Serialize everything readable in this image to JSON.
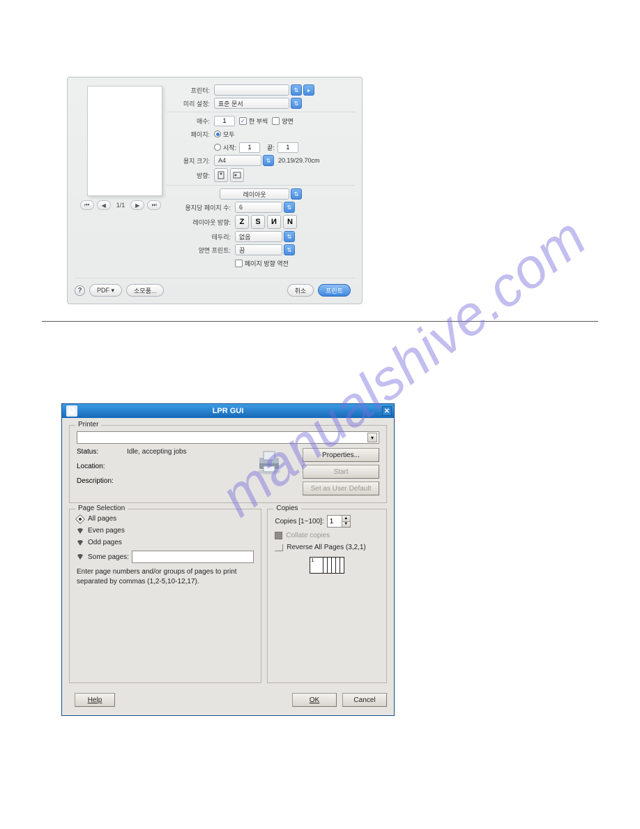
{
  "mac": {
    "labels": {
      "printer": "프린터:",
      "preset": "미리 설정:",
      "copies": "매수:",
      "pages": "페이지:",
      "paper": "용지 크기:",
      "orient": "방향:",
      "perSheet": "용지당 페이지 수:",
      "layoutDir": "레이아웃 방향:",
      "border": "테두리:",
      "duplex": "양면 프린트:"
    },
    "preset_value": "표준 문서",
    "copies_value": "1",
    "collate": "한 부씩",
    "duplex_cb": "양면",
    "pages_all": "모두",
    "pages_from": "시작:",
    "pages_to": "끝:",
    "from_value": "1",
    "to_value": "1",
    "paper_value": "A4",
    "paper_dim": "20.19/29.70cm",
    "section_value": "레이아웃",
    "perSheet_value": "6",
    "border_value": "없음",
    "duplex_value": "끔",
    "flip": "페이지 방향 역전",
    "pager": "1/1",
    "buttons": {
      "pdf": "PDF ▾",
      "supply": "소모품...",
      "cancel": "취소",
      "print": "프린트"
    }
  },
  "lpr": {
    "title": "LPR GUI",
    "printer": {
      "legend": "Printer",
      "status_lbl": "Status:",
      "status_val": "Idle, accepting jobs",
      "location_lbl": "Location:",
      "desc_lbl": "Description:",
      "properties": "Properties...",
      "start": "Start",
      "default": "Set as User Default"
    },
    "pagesel": {
      "legend": "Page Selection",
      "all": "All pages",
      "even": "Even pages",
      "odd": "Odd pages",
      "some": "Some pages:",
      "hint": "Enter page numbers and/or groups of pages to print separated by commas (1,2-5,10-12,17)."
    },
    "copies": {
      "legend": "Copies",
      "label": "Copies [1~100]:",
      "value": "1",
      "collate": "Collate copies",
      "reverse": "Reverse All Pages (3,2,1)"
    },
    "footer": {
      "help": "Help",
      "ok": "OK",
      "cancel": "Cancel"
    }
  }
}
